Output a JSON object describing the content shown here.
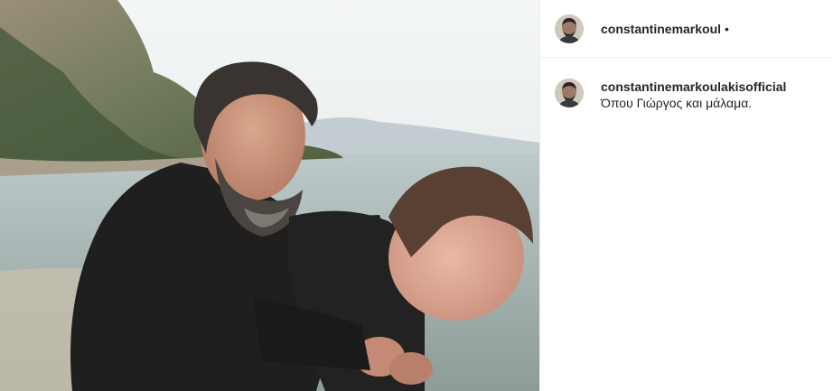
{
  "post": {
    "image_alt": "Photo of two people by the sea",
    "header": {
      "username": "constantinemarkoul",
      "separator": "•"
    },
    "caption": {
      "username": "constantinemarkoulakisofficial",
      "text": "Όπου Γιώργος και μάλαμα."
    }
  },
  "colors": {
    "text": "#262626",
    "divider": "#efefef"
  }
}
